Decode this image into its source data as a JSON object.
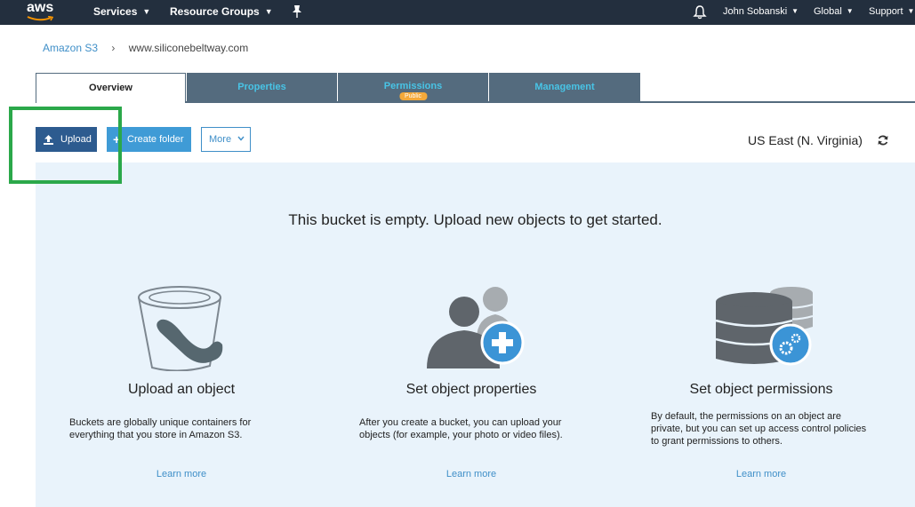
{
  "topnav": {
    "logo_text": "aws",
    "services_label": "Services",
    "resource_groups_label": "Resource Groups",
    "user_label": "John Sobanski",
    "region_menu_label": "Global",
    "support_label": "Support"
  },
  "breadcrumb": {
    "root": "Amazon S3",
    "separator": "›",
    "current": "www.siliconebeltway.com"
  },
  "tabs": [
    {
      "label": "Overview",
      "active": true
    },
    {
      "label": "Properties",
      "active": false
    },
    {
      "label": "Permissions",
      "active": false,
      "badge": "Public"
    },
    {
      "label": "Management",
      "active": false
    }
  ],
  "toolbar": {
    "upload_label": "Upload",
    "create_folder_label": "Create folder",
    "more_label": "More",
    "region": "US East (N. Virginia)"
  },
  "empty_state": {
    "message": "This bucket is empty. Upload new objects to get started.",
    "columns": [
      {
        "title": "Upload an object",
        "desc_lines": [
          "Buckets are globally unique containers for",
          "everything that you store in Amazon S3."
        ],
        "link": "Learn more",
        "icon": "bucket-icon"
      },
      {
        "title": "Set object properties",
        "desc_lines": [
          "After you create a bucket, you can upload your",
          "objects (for example, your photo or video files)."
        ],
        "link": "Learn more",
        "icon": "users-add-icon"
      },
      {
        "title": "Set object permissions",
        "desc_lines": [
          "By default, the permissions on an object are",
          "private, but you can set up access control policies",
          "to grant permissions to others."
        ],
        "link": "Learn more",
        "icon": "database-settings-icon"
      }
    ]
  },
  "colors": {
    "nav_bg": "#232f3e",
    "tab_bg": "#546b7e",
    "tab_text": "#48c4e6",
    "primary_button": "#2d5b8f",
    "secondary_button": "#3f9bd6",
    "link": "#3f8fc8",
    "panel_bg": "#e9f3fb",
    "highlight": "#2ba84a",
    "badge": "#f4a93a"
  }
}
